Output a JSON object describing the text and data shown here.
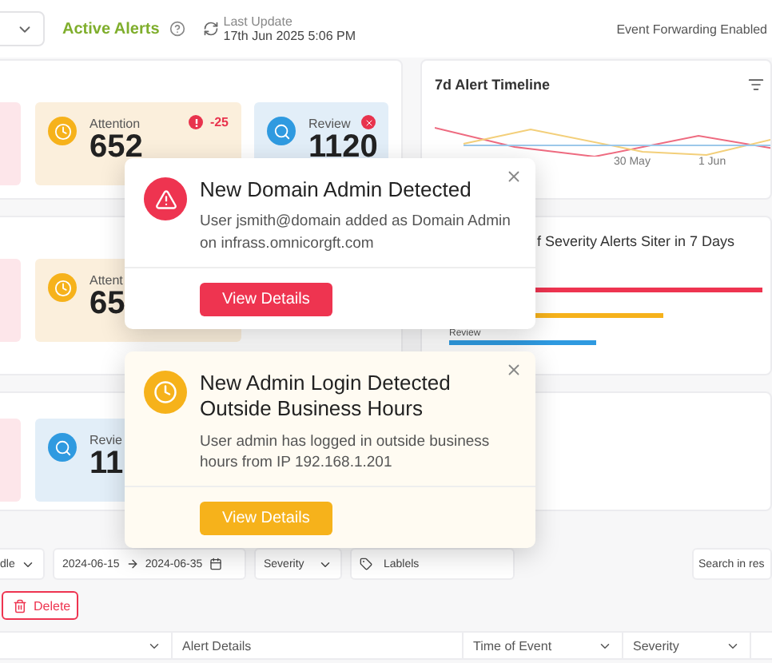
{
  "header": {
    "title": "Active Alerts",
    "last_update_label": "Last Update",
    "last_update": "17th Jun 2025 5:06 PM",
    "status": "Event Forwarding Enabled"
  },
  "stat_rows": [
    {
      "cards": [
        {
          "kind": "critical"
        },
        {
          "kind": "attention",
          "label": "Attention",
          "value": "652",
          "alert": true,
          "change": "-25"
        },
        {
          "kind": "review",
          "label": "Review",
          "value": "1120",
          "alert": true
        }
      ]
    },
    {
      "cards": [
        {
          "kind": "critical"
        },
        {
          "kind": "attention",
          "label": "Attent",
          "value": "65"
        }
      ]
    },
    {
      "cards": [
        {
          "kind": "critical"
        },
        {
          "kind": "review",
          "label": "Revie",
          "value": "11"
        }
      ]
    }
  ],
  "timeline": {
    "title": "7d Alert Timeline",
    "x_labels": [
      "30 May",
      "1 Jun"
    ]
  },
  "severity_chart": {
    "title": "f Severity Alerts Siter in 7 Days",
    "bar_label": "Review"
  },
  "toasts": [
    {
      "kind": "danger",
      "title": "New Domain Admin Detected",
      "message": "User jsmith@domain added as Domain Admin on infrass.omnicorgft.com",
      "button": "View Details"
    },
    {
      "kind": "warning",
      "title": "New Admin Login Detected Outside Business Hours",
      "message": "User admin has logged in outside business hours from IP 192.168.1.201",
      "button": "View Details"
    }
  ],
  "filters": {
    "type_select": "dle",
    "date_from": "2024-06-15",
    "date_to": "2024-06-35",
    "severity": "Severity",
    "labels": "Lablels",
    "search_placeholder": "Search in res"
  },
  "delete_button": "Delete",
  "table": {
    "columns": [
      {
        "menu": true
      },
      {
        "label": "Alert Details",
        "menu": false
      },
      {
        "label": "Time of Event",
        "menu": true
      },
      {
        "label": "Severity",
        "menu": true
      }
    ]
  }
}
